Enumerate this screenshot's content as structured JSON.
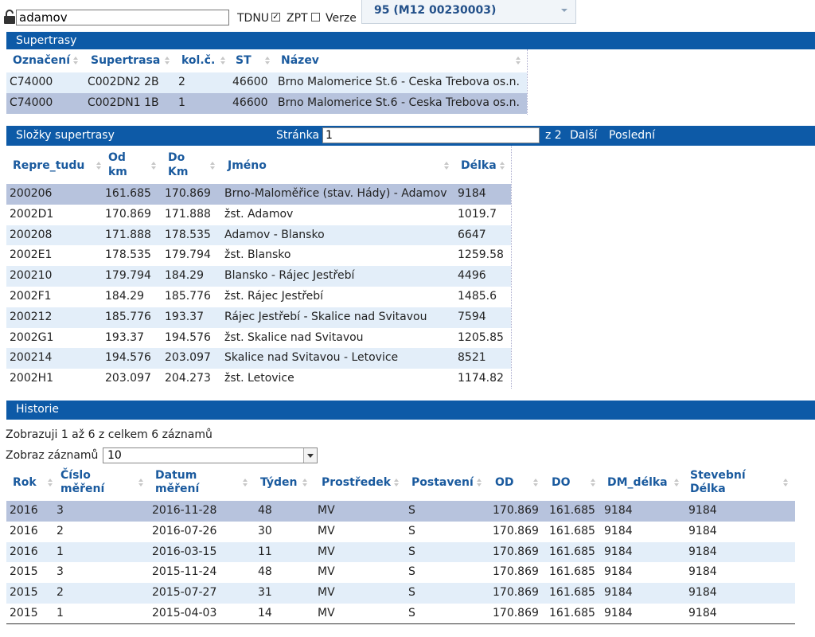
{
  "top": {
    "search_value": "adamov",
    "tdnu_label": "TDNU",
    "zpt_label": "ZPT",
    "zpt_checked": "✓",
    "verze_label": "Verze",
    "dropdown_value": "95 (M12 00230003)"
  },
  "supertrasy": {
    "title": "Supertrasy",
    "columns": [
      "Označení",
      "Supertrasa",
      "kol.č.",
      "ST",
      "Název"
    ],
    "rows": [
      [
        "C74000",
        "C002DN2 2B",
        "2",
        "46600",
        "Brno Malomerice St.6 - Ceska Trebova os.n."
      ],
      [
        "C74000",
        "C002DN1 1B",
        "1",
        "46600",
        "Brno Malomerice St.6 - Ceska Trebova os.n."
      ]
    ]
  },
  "slozky": {
    "title": "Složky supertrasy",
    "page_label": "Stránka",
    "page_value": "1",
    "page_of": "z 2",
    "next": "Další",
    "last": "Poslední",
    "columns": [
      "Repre_tudu",
      "Od km",
      "Do Km",
      "Jméno",
      "Délka"
    ],
    "col_od_1": "Od",
    "col_od_2": "km",
    "col_do_1": "Do",
    "col_do_2": "Km",
    "rows": [
      [
        "200206",
        "161.685",
        "170.869",
        "Brno-Maloměřice (stav. Hády) - Adamov",
        "9184"
      ],
      [
        "2002D1",
        "170.869",
        "171.888",
        "žst. Adamov",
        "1019.7"
      ],
      [
        "200208",
        "171.888",
        "178.535",
        "Adamov - Blansko",
        "6647"
      ],
      [
        "2002E1",
        "178.535",
        "179.794",
        "žst. Blansko",
        "1259.58"
      ],
      [
        "200210",
        "179.794",
        "184.29",
        "Blansko - Rájec Jestřebí",
        "4496"
      ],
      [
        "2002F1",
        "184.29",
        "185.776",
        "žst. Rájec Jestřebí",
        "1485.6"
      ],
      [
        "200212",
        "185.776",
        "193.37",
        "Rájec Jestřebí - Skalice nad Svitavou",
        "7594"
      ],
      [
        "2002G1",
        "193.37",
        "194.576",
        "žst. Skalice nad Svitavou",
        "1205.85"
      ],
      [
        "200214",
        "194.576",
        "203.097",
        "Skalice nad Svitavou - Letovice",
        "8521"
      ],
      [
        "2002H1",
        "203.097",
        "204.273",
        "žst. Letovice",
        "1174.82"
      ]
    ]
  },
  "historie": {
    "title": "Historie",
    "info": "Zobrazuji 1 až 6 z celkem 6 záznamů",
    "show_label": "Zobraz záznamů",
    "show_value": "10",
    "col_rok": "Rok",
    "col_cislo_1": "Číslo",
    "col_cislo_2": "měření",
    "col_datum_1": "Datum",
    "col_datum_2": "měření",
    "col_tyden": "Týden",
    "col_prostredek": "Prostředek",
    "col_postaveni": "Postavení",
    "col_od": "OD",
    "col_do": "DO",
    "col_dm": "DM_délka",
    "col_stev_1": "Stevební",
    "col_stev_2": "Délka",
    "rows": [
      [
        "2016",
        "3",
        "2016-11-28",
        "48",
        "MV",
        "S",
        "170.869",
        "161.685",
        "9184",
        "9184"
      ],
      [
        "2016",
        "2",
        "2016-07-26",
        "30",
        "MV",
        "S",
        "170.869",
        "161.685",
        "9184",
        "9184"
      ],
      [
        "2016",
        "1",
        "2016-03-15",
        "11",
        "MV",
        "S",
        "170.869",
        "161.685",
        "9184",
        "9184"
      ],
      [
        "2015",
        "3",
        "2015-11-24",
        "48",
        "MV",
        "S",
        "170.869",
        "161.685",
        "9184",
        "9184"
      ],
      [
        "2015",
        "2",
        "2015-07-27",
        "31",
        "MV",
        "S",
        "170.869",
        "161.685",
        "9184",
        "9184"
      ],
      [
        "2015",
        "1",
        "2015-04-03",
        "14",
        "MV",
        "S",
        "170.869",
        "161.685",
        "9184",
        "9184"
      ]
    ]
  },
  "colors": {
    "header_bar": "#0d5aa7",
    "row_selected": "#b7c3dd",
    "row_alt": "#e3eef9",
    "header_text": "#1a5a9e"
  }
}
